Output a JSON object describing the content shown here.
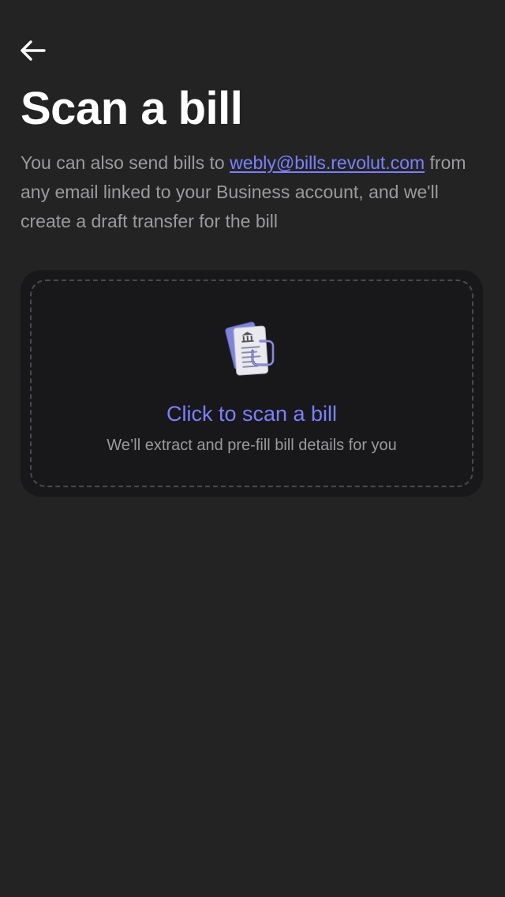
{
  "header": {
    "back_icon": "arrow-left-icon",
    "title": "Scan a bill"
  },
  "description": {
    "text_before": "You can also send bills to ",
    "email": "webly@bills.revolut.com",
    "text_after": " from any email linked to your Business account, and we'll create a draft transfer for the bill"
  },
  "scan_card": {
    "icon": "bill-document-icon",
    "cta_label": "Click to scan a bill",
    "subtitle": "We’ll extract and pre-fill bill details for you"
  },
  "colors": {
    "background": "#232323",
    "card": "#18181a",
    "accent": "#7b80ff",
    "muted_text": "#9b9b9f"
  }
}
